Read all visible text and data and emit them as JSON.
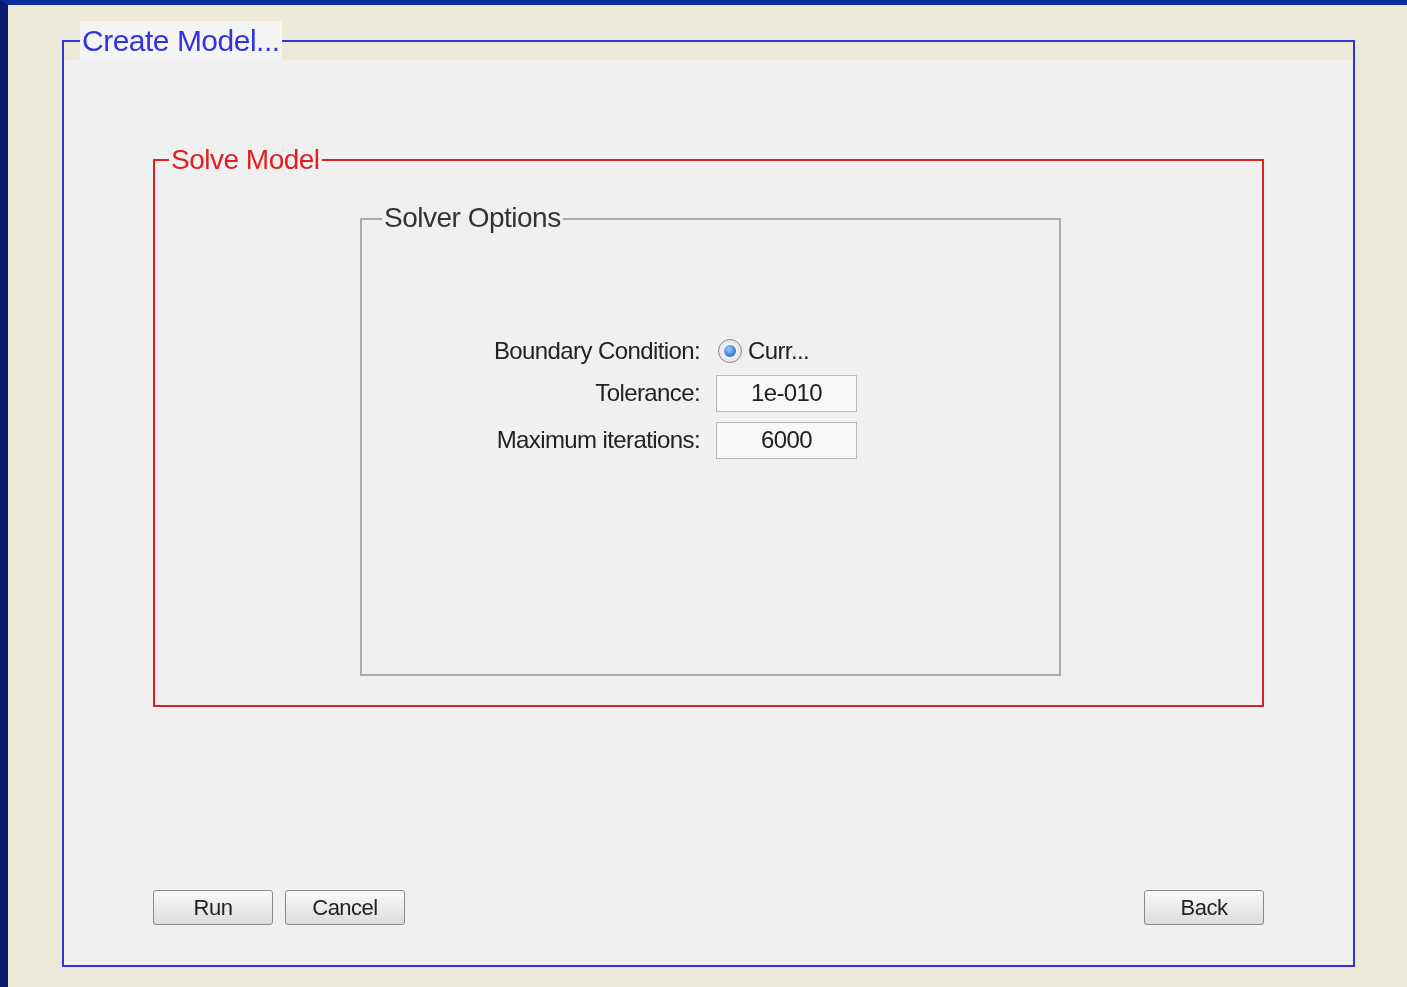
{
  "window": {
    "title": "Create Model..."
  },
  "section": {
    "title": "Solve Model",
    "options": {
      "title": "Solver Options",
      "fields": [
        {
          "kind": "radio",
          "label": "Boundary Condition:",
          "option": "Curr...",
          "selected": true
        },
        {
          "kind": "text",
          "label": "Tolerance:",
          "value": "1e-010"
        },
        {
          "kind": "text",
          "label": "Maximum iterations:",
          "value": "6000"
        }
      ]
    }
  },
  "left_buttons": [
    "Run",
    "Cancel"
  ],
  "right_buttons": [
    "Back"
  ]
}
